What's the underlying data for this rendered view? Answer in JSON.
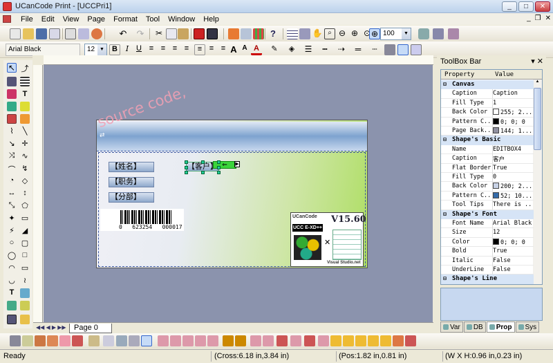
{
  "window": {
    "title": "UCanCode Print - [UCCPri1]"
  },
  "menu": [
    "File",
    "Edit",
    "View",
    "Page",
    "Format",
    "Tool",
    "Window",
    "Help"
  ],
  "toolbar": {
    "zoom_value": "100"
  },
  "format_toolbar": {
    "font_name": "Arial Black",
    "font_size": "12"
  },
  "design": {
    "watermark": "source code,",
    "fields": [
      "【姓名】",
      "【职务】",
      "【分部】"
    ],
    "selected_label": "【客户】",
    "barcode_text": "0   623254   000017",
    "product_image": {
      "brand": "UCanCode",
      "product": "UCC E-XD++",
      "version": "V15.60",
      "footer": "Visual Studio.net"
    }
  },
  "page_tab": "Page   0",
  "status": {
    "ready": "Ready",
    "cross": "(Cross:6.18 in,3.84 in)",
    "pos": "(Pos:1.82 in,0.81 in)",
    "size": "(W X H:0.96 in,0.23 in)"
  },
  "toolbox": {
    "title": "ToolBox Bar",
    "header": {
      "property": "Property",
      "value": "Value"
    },
    "sections": [
      {
        "name": "Canvas",
        "rows": [
          {
            "k": "Caption",
            "v": "Caption"
          },
          {
            "k": "Fill Type",
            "v": "1"
          },
          {
            "k": "Back Color",
            "v": "255; 2...",
            "swatch": "#ffffff"
          },
          {
            "k": "Pattern C...",
            "v": "0; 0; 0",
            "swatch": "#000000"
          },
          {
            "k": "Page Back...",
            "v": "144; 1...",
            "swatch": "#9090a0"
          }
        ]
      },
      {
        "name": "Shape's Basic",
        "rows": [
          {
            "k": "Name",
            "v": "EDITBOX4"
          },
          {
            "k": "Caption",
            "v": "客户"
          },
          {
            "k": "Flat Border",
            "v": "True"
          },
          {
            "k": "Fill Type",
            "v": "0"
          },
          {
            "k": "Back Color",
            "v": "200; 2...",
            "swatch": "#c8d2e6"
          },
          {
            "k": "Pattern C...",
            "v": "52; 10...",
            "swatch": "#346aa8"
          },
          {
            "k": "Tool Tips",
            "v": "There is ..."
          }
        ]
      },
      {
        "name": "Shape's Font",
        "rows": [
          {
            "k": "Font Name",
            "v": "Arial Black"
          },
          {
            "k": "Size",
            "v": "12"
          },
          {
            "k": "Color",
            "v": "0; 0; 0",
            "swatch": "#000000"
          },
          {
            "k": "Bold",
            "v": "True"
          },
          {
            "k": "Italic",
            "v": "False"
          },
          {
            "k": "UnderLine",
            "v": "False"
          }
        ]
      },
      {
        "name": "Shape's Line",
        "rows": []
      }
    ],
    "tabs": [
      "Var",
      "DB",
      "Prop",
      "Sys"
    ]
  }
}
